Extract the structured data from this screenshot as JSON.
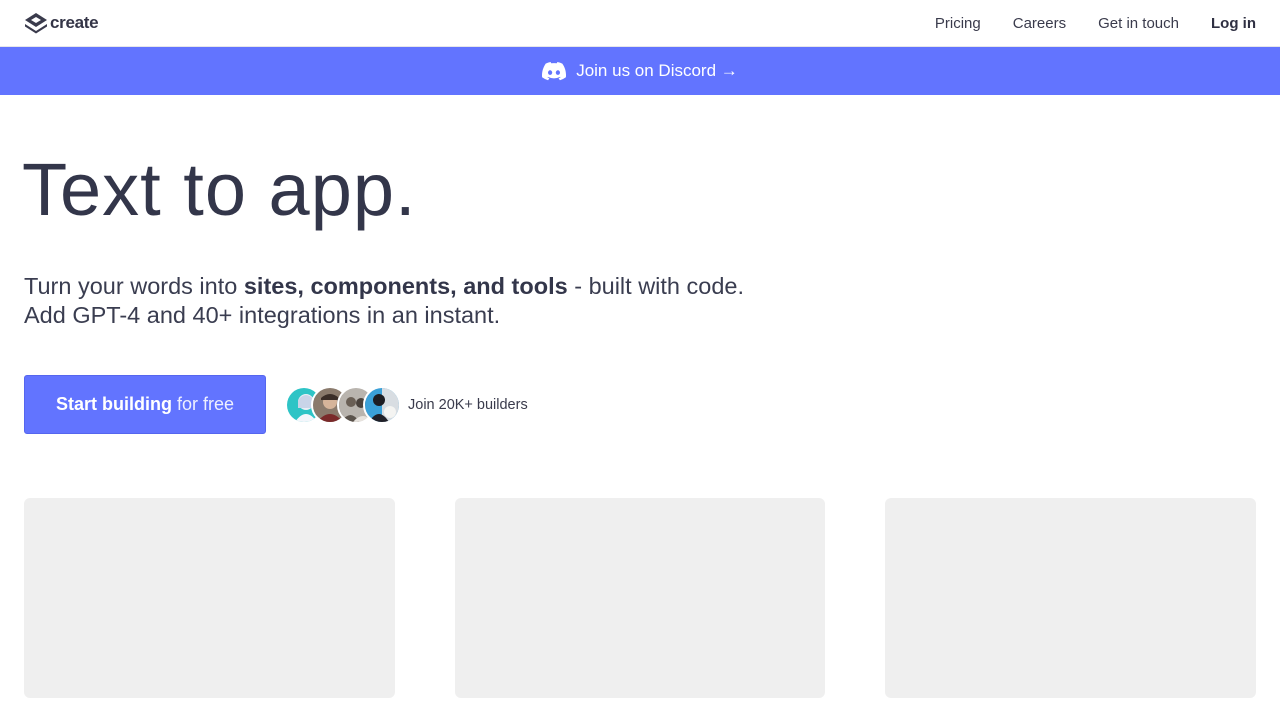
{
  "header": {
    "logo_text": "create",
    "nav": [
      {
        "label": "Pricing"
      },
      {
        "label": "Careers"
      },
      {
        "label": "Get in touch"
      },
      {
        "label": "Log in"
      }
    ]
  },
  "banner": {
    "label": "Join us on Discord →",
    "icon": "discord-icon",
    "background": "#6274ff"
  },
  "hero": {
    "title": "Text to app.",
    "subtitle_line1_prefix": "Turn your words into ",
    "subtitle_line1_bold": "sites, components, and tools",
    "subtitle_line1_suffix": " - built with code.",
    "subtitle_line2": "Add GPT-4 and 40+ integrations in an instant."
  },
  "cta": {
    "label_bold": "Start building",
    "label_light": "for free",
    "color": "#6274ff"
  },
  "social_proof": {
    "text": "Join 20K+ builders",
    "avatars": [
      "avatar-1",
      "avatar-2",
      "avatar-3",
      "avatar-4"
    ]
  },
  "cards": [
    {
      "name": "preview-card-1"
    },
    {
      "name": "preview-card-2"
    },
    {
      "name": "preview-card-3"
    }
  ]
}
